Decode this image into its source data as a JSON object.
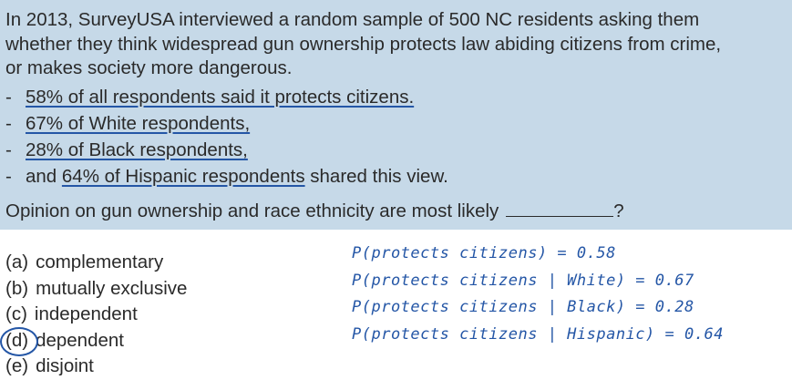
{
  "intro": {
    "line1": "In 2013, SurveyUSA interviewed a random sample of 500 NC residents asking them",
    "line2": "whether they think widespread gun ownership protects law abiding citizens from crime,",
    "line3": "or makes society more dangerous."
  },
  "bullets": [
    {
      "dash": "-",
      "text": "58% of all respondents said it protects citizens."
    },
    {
      "dash": "-",
      "text": "67% of White respondents,"
    },
    {
      "dash": "-",
      "text": "28% of Black respondents,"
    },
    {
      "dash": "-",
      "pre": "and ",
      "text": "64% of Hispanic respondents",
      "post": " shared this view."
    }
  ],
  "question": {
    "text": "Opinion on gun ownership and race ethnicity are most likely",
    "end": "?"
  },
  "options": [
    {
      "letter": "(a)",
      "label": "complementary"
    },
    {
      "letter": "(b)",
      "label": "mutually exclusive"
    },
    {
      "letter": "(c)",
      "label": "independent"
    },
    {
      "letter": "(d)",
      "label": "dependent",
      "selected": true
    },
    {
      "letter": "(e)",
      "label": "disjoint"
    }
  ],
  "notes": [
    "P(protects citizens) = 0.58",
    "P(protects citizens | White) = 0.67",
    "P(protects citizens | Black) = 0.28",
    "P(protects citizens | Hispanic) = 0.64"
  ],
  "colors": {
    "panel": "#c6d9e8",
    "ink": "#2456a6",
    "text": "#2a2a2a"
  }
}
